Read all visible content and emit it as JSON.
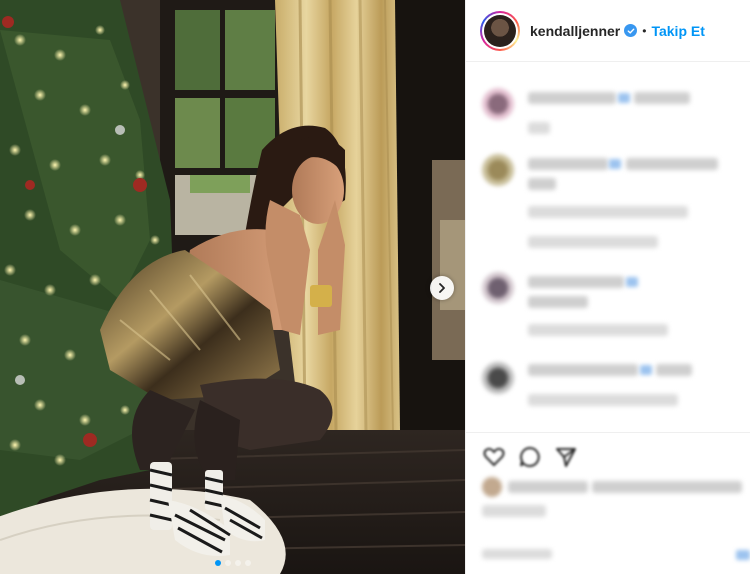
{
  "post": {
    "username": "kendalljenner",
    "separator": "•",
    "follow_label": "Takip Et",
    "verified": true
  },
  "carousel": {
    "slide_count": 4,
    "active_slide": 1
  },
  "icons": {
    "next": "chevron-right-icon",
    "verified": "verified-badge-icon",
    "like": "heart-icon",
    "comment": "comment-icon",
    "share": "share-icon"
  },
  "colors": {
    "accent": "#0095f6",
    "verified": "#3897f0",
    "text": "#262626",
    "divider": "#efefef"
  }
}
